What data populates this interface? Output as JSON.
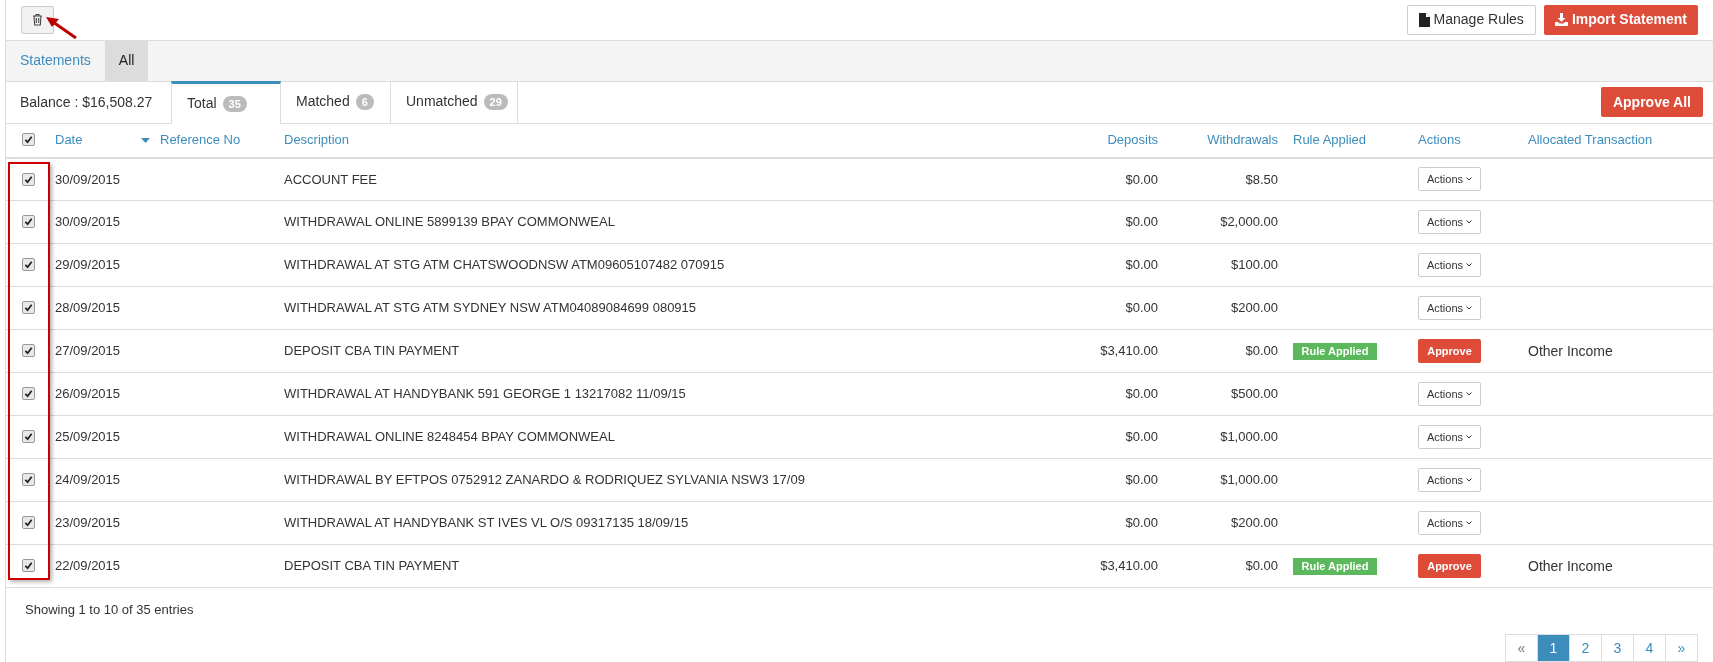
{
  "toolbar": {
    "manage_rules": "Manage Rules",
    "import_statement": "Import Statement"
  },
  "nav_tabs": [
    {
      "label": "Statements",
      "selected": false
    },
    {
      "label": "All",
      "selected": true
    }
  ],
  "balance": "Balance : $16,508.27",
  "filter_tabs": [
    {
      "label": "Total",
      "count": "35",
      "selected": true
    },
    {
      "label": "Matched",
      "count": "6",
      "selected": false
    },
    {
      "label": "Unmatched",
      "count": "29",
      "selected": false
    }
  ],
  "approve_all": "Approve All",
  "table": {
    "select_all_checked": true,
    "columns": [
      "Date",
      "Reference No",
      "Description",
      "Deposits",
      "Withdrawals",
      "Rule Applied",
      "Actions",
      "Allocated Transaction"
    ],
    "rows": [
      {
        "checked": true,
        "date": "30/09/2015",
        "description": "ACCOUNT FEE",
        "deposits": "$0.00",
        "withdrawals": "$8.50",
        "kind": "actions",
        "action": "Actions"
      },
      {
        "checked": true,
        "date": "30/09/2015",
        "description": "WITHDRAWAL ONLINE 5899139 BPAY COMMONWEAL",
        "deposits": "$0.00",
        "withdrawals": "$2,000.00",
        "kind": "actions",
        "action": "Actions"
      },
      {
        "checked": true,
        "date": "29/09/2015",
        "description": "WITHDRAWAL AT STG ATM CHATSWOODNSW ATM09605107482 070915",
        "deposits": "$0.00",
        "withdrawals": "$100.00",
        "kind": "actions",
        "action": "Actions"
      },
      {
        "checked": true,
        "date": "28/09/2015",
        "description": "WITHDRAWAL AT STG ATM SYDNEY NSW ATM04089084699 080915",
        "deposits": "$0.00",
        "withdrawals": "$200.00",
        "kind": "actions",
        "action": "Actions"
      },
      {
        "checked": true,
        "date": "27/09/2015",
        "description": "DEPOSIT CBA TIN PAYMENT",
        "deposits": "$3,410.00",
        "withdrawals": "$0.00",
        "kind": "approve",
        "rule": "Rule Applied",
        "action": "Approve",
        "allocated": "Other Income"
      },
      {
        "checked": true,
        "date": "26/09/2015",
        "description": "WITHDRAWAL AT HANDYBANK 591 GEORGE 1 13217082 11/09/15",
        "deposits": "$0.00",
        "withdrawals": "$500.00",
        "kind": "actions",
        "action": "Actions"
      },
      {
        "checked": true,
        "date": "25/09/2015",
        "description": "WITHDRAWAL ONLINE 8248454 BPAY COMMONWEAL",
        "deposits": "$0.00",
        "withdrawals": "$1,000.00",
        "kind": "actions",
        "action": "Actions"
      },
      {
        "checked": true,
        "date": "24/09/2015",
        "description": "WITHDRAWAL BY EFTPOS 0752912 ZANARDO & RODRIQUEZ SYLVANIA NSW3 17/09",
        "deposits": "$0.00",
        "withdrawals": "$1,000.00",
        "kind": "actions",
        "action": "Actions"
      },
      {
        "checked": true,
        "date": "23/09/2015",
        "description": "WITHDRAWAL AT HANDYBANK ST IVES VL O/S 09317135 18/09/15",
        "deposits": "$0.00",
        "withdrawals": "$200.00",
        "kind": "actions",
        "action": "Actions"
      },
      {
        "checked": true,
        "date": "22/09/2015",
        "description": "DEPOSIT CBA TIN PAYMENT",
        "deposits": "$3,410.00",
        "withdrawals": "$0.00",
        "kind": "approve",
        "rule": "Rule Applied",
        "action": "Approve",
        "allocated": "Other Income"
      }
    ]
  },
  "footer": "Showing 1 to 10 of 35 entries",
  "pagination": [
    {
      "label": "«",
      "selected": false
    },
    {
      "label": "1",
      "selected": true
    },
    {
      "label": "2",
      "selected": false
    },
    {
      "label": "3",
      "selected": false
    },
    {
      "label": "4",
      "selected": false
    },
    {
      "label": "»",
      "selected": false
    }
  ]
}
